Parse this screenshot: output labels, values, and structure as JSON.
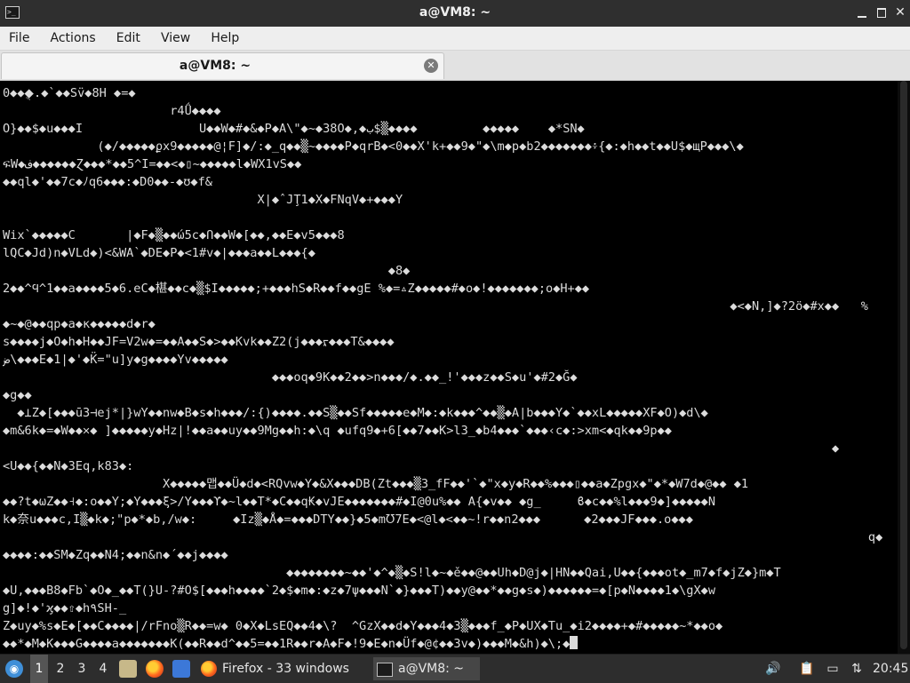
{
  "window": {
    "title": "a@VM8: ~"
  },
  "menu": [
    "File",
    "Actions",
    "Edit",
    "View",
    "Help"
  ],
  "tab": {
    "label": "a@VM8: ~"
  },
  "terminal": {
    "lines": [
      "0◆◆◆ֻ.◆`◆◆Sv̈◆8H ◆=◆",
      "                       r4Ǘ◆◆◆◆",
      "O}◆◆$◆u◆◆◆I                U◆◆W◆#◆&◆P◆A\\\"◆~◆38O◆,◆ب$▒◆◆◆◆         ◆◆◆◆◆    ◆*SN◆",
      "             (◆/◆◆◆◆◆ϼx9◆◆◆◆◆@¦F]◆/:◆_q◆◆▒~◆◆◆◆P◆qrB◆<0◆◆X'k+◆◆9◆\"◆\\m◆p◆b2◆◆◆◆◆◆◆፥{◆:◆h◆◆t◆◆U$◆щP◆◆◆\\◆",
      "ፍW◆ف◆◆◆◆◆◆Ɀ◆◆◆*◆◆5^I=◆◆<◆▯~◆◆◆◆◆l◆WX1vS◆◆",
      "◆◆ql◆'◆◆7c◆ﾉq6◆◆◆:◆D0◆◆-◆ʊ◆f&",
      "                                   X|◆ˆJŢ1◆X◆FNqV◆+◆◆◆Y",
      "",
      "Wix`◆◆◆◆◆C       |◆F◆▒◆◆ώ5c◆Ո◆◆W◆[◆◆,◆◆E◆v5◆◆◆8",
      "lQC◆Jd)n◆VLd◆)<&WA`◆DE◆P◆<1#v◆|◆◆◆a◆◆L◆◆◆{◆",
      "                                                     ◆8◆",
      "2◆◆^Ϥ^1◆◆a◆◆◆◆5◆6.eC◆椹◆◆c◆▒$I◆◆◆◆◆;+◆◆◆hS◆R◆◆f◆◆gE %◆=▵Z◆◆◆◆◆#◆o◆!◆◆◆◆◆◆◆;o◆H+◆◆",
      "                                                                                                    ◆<◆N,]◆?2ö◆#x◆◆   %",
      "◆~◆@◆◆qp◆a◆ĸ◆◆◆◆◆d◆r◆",
      "s◆◆◆◆j◆O◆h◆H◆◆JF=V2w◆=◆◆A◆◆S◆>◆◆Kvk◆◆Z2(j◆◆◆ᡵ◆◆◆T&◆◆◆◆",
      "ض\\◆◆◆E◆1|◆'◆K̈=\"u]y◆g◆◆◆◆Yv◆◆◆◆◆",
      "                                     ◆◆◆oq◆9K◆◆2◆◆>n◆◆◆/◆.◆◆_!'◆◆◆z◆◆S◆u'◆#2◆Ğ◆",
      "◆g◆◆",
      "  ◆⊥Z◆[◆◆◆ū3⊣ej*|}wY◆◆nw◆B◆s◆h◆◆◆/:{)◆◆◆◆.◆◆S▒◆◆Sf◆◆◆◆◆e◆M◆:◆k◆◆◆^◆◆▒◆A|b◆◆◆Y◆`◆◆xL◆◆◆◆◆XF◆O)◆d\\◆",
      "◆m&6k◆=◆W◆◆✕◆ ]◆◆◆◆◆y◆Hz|!◆◆a◆◆uy◆◆9Mg◆◆h:◆\\q ◆ufq9◆+6[◆◆7◆◆K>l3_◆b4◆◆◆`◆◆◆‹c◆:>xm<◆qk◆◆9p◆◆",
      "                                                                                                                  ◆",
      "<U◆◆{◆◆N◆3Eq,k83◆:",
      "                      X◆◆◆◆◆맵◆◆Ü◆d◆<RQvw◆Y◆&X◆◆◆DB(Zt◆◆◆▒3_fF◆◆'`◆\"x◆y◆R◆◆%◆◆◆▯◆◆a◆Zpgx◆\"◆*◆W7d◆@◆◆ ◆1",
      "◆◆?t◆ωZ◆◆˧◆:o◆◆Y;◆Y◆◆◆ξ>/Y◆◆◆ϒ◆~l◆◆T*◆C◆◆q₭◆vJE◆◆◆◆◆◆◆#◆I@0u%◆◆ A{◆v◆◆ ◆g_     ϐ◆c◆◆%l◆◆◆9◆]◆◆◆◆◆N",
      "k◆奈u◆◆◆c,I▒◆k◆;\"p◆*◆b,/w◆:     ◆Iz▒◆Å◆=◆◆◆DTY◆◆}◆5◆m℧7E◆<@l◆<◆◆~!r◆◆n2◆◆◆      ◆2◆◆◆JF◆◆◆.o◆◆◆",
      "                                                                                                                       q◆◆n◆",
      "◆◆◆◆:◆◆SM◆Zq◆◆N4;◆◆n&n◆´◆◆j◆◆◆◆",
      "                                       ◆◆◆◆◆◆◆◆~◆◆'◆^◆▒◆S!l◆~◆ě◆◆@◆◆Uh◆D@j◆|HN◆◆Qai,U◆◆{◆◆◆ot◆_m7◆f◆jZ◆}m◆T",
      "◆U,◆◆◆B8◆Fb`◆O◆_◆◆T(}U-?#O$[◆◆◆h◆◆◆◆`2◆$◆m◆:◆z◆7ψ◆◆◆N`◆}◆◆◆T)◆◆y@◆◆*◆◆g◆s◆)◆◆◆◆◆◆=◆[p◆N◆◆◆◆1◆\\gX◆w",
      "g]◆!◆'ϗ◆◆⇧◆h٩SH-_",
      "Z◆uy◆%s◆E◆[◆◆C◆◆◆◆|/rFno▒R◆◆=w◆ 0◆X◆LsEQ◆◆4◆\\?  ^GzX◆◆d◆Y◆◆◆4◆3▒◆◆◆f_◆P◆UX◆Tu_◆i2◆◆◆◆+◆#◆◆◆◆◆~*◆◆o◆",
      "◆◆*◆M◆K◆◆◆G◆◆◆◆a◆◆◆◆◆◆◆K(◆◆R◆◆d^◆◆5=◆◆1R◆◆r◆A◆F◆!9◆E◆n◆Üf◆@¢◆◆3v◆)◆◆◆M◆&h)◆\\;◆"
    ]
  },
  "taskbar": {
    "workspaces": [
      "1",
      "2",
      "3",
      "4"
    ],
    "tasks": [
      {
        "label": "Firefox - 33 windows"
      },
      {
        "label": "a@VM8: ~"
      }
    ],
    "clock": "20:45"
  }
}
